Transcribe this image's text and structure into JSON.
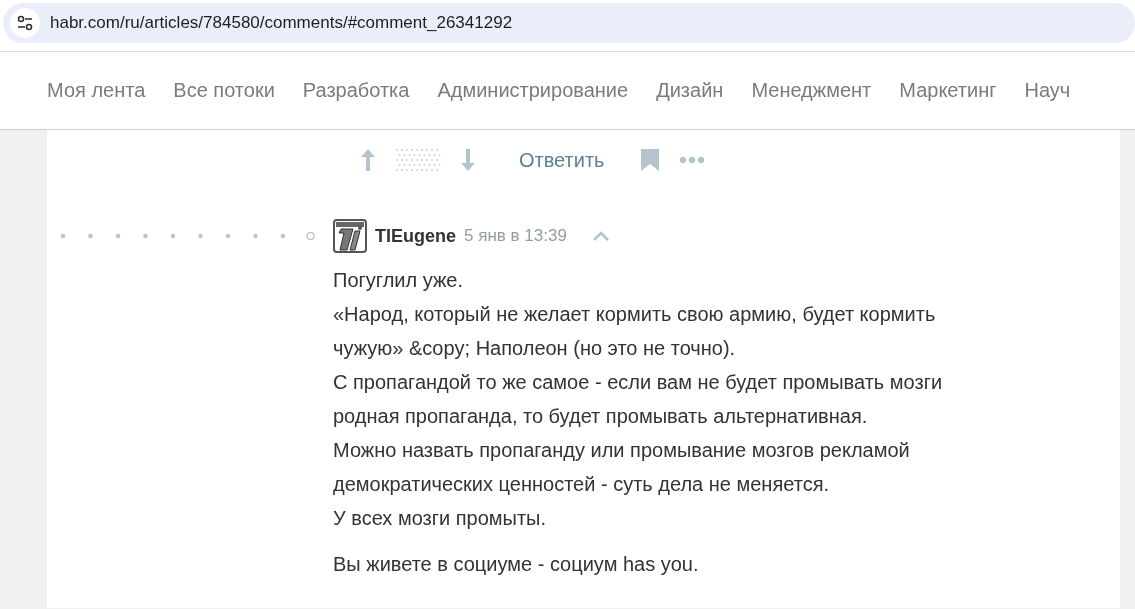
{
  "address_bar": {
    "url": "habr.com/ru/articles/784580/comments/#comment_26341292"
  },
  "nav": {
    "items": [
      {
        "label": "Моя лента"
      },
      {
        "label": "Все потоки"
      },
      {
        "label": "Разработка"
      },
      {
        "label": "Администрирование"
      },
      {
        "label": "Дизайн"
      },
      {
        "label": "Менеджмент"
      },
      {
        "label": "Маркетинг"
      },
      {
        "label": "Науч"
      }
    ]
  },
  "prev_comment_actions": {
    "reply": "Ответить"
  },
  "comment": {
    "author": "TIEugene",
    "time": "5 янв в 13:39",
    "lines": [
      "Погуглил уже.",
      "«Народ, который не желает кормить свою армию, будет кормить",
      "чужую» &copy; Наполеон (но это не точно).",
      "С пропагандой то же самое - если вам не будет промывать мозги",
      "родная пропаганда, то будет промывать альтернативная.",
      "Можно назвать пропаганду или промывание мозгов рекламой",
      "демократических ценностей - суть дела не меняется.",
      "У всех мозги промыты."
    ],
    "last_paragraph": "Вы живете в социуме - социум has you."
  }
}
